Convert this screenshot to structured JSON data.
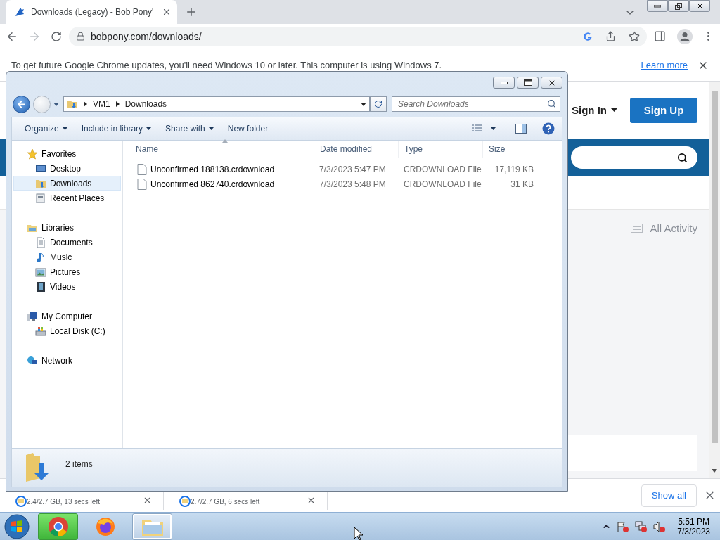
{
  "browser": {
    "tabs": [
      {
        "title": "Downloads (Legacy) - Bob Pony'",
        "selected": true
      }
    ],
    "address": "bobpony.com/downloads/",
    "infobar": {
      "message": "To get future Google Chrome updates, you'll need Windows 10 or later. This computer is using Windows 7.",
      "link": "Learn more"
    }
  },
  "page": {
    "sign_in": "Sign In",
    "sign_up": "Sign Up",
    "all_activity": "All Activity"
  },
  "download_shelf": {
    "items": [
      {
        "status": "2.4/2.7 GB, 13 secs left"
      },
      {
        "status": "2.7/2.7 GB, 6 secs left"
      }
    ],
    "show_all": "Show all"
  },
  "explorer": {
    "breadcrumb": [
      "VM1",
      "Downloads"
    ],
    "search": {
      "placeholder": "Search Downloads"
    },
    "toolbar": [
      {
        "label": "Organize",
        "menu": true
      },
      {
        "label": "Include in library",
        "menu": true
      },
      {
        "label": "Share with",
        "menu": true
      },
      {
        "label": "New folder",
        "menu": false
      }
    ],
    "nav": [
      {
        "label": "Favorites",
        "kind": "star",
        "selected": false,
        "children": [
          {
            "label": "Desktop",
            "kind": "desktop",
            "selected": false
          },
          {
            "label": "Downloads",
            "kind": "downloads",
            "selected": true
          },
          {
            "label": "Recent Places",
            "kind": "recent",
            "selected": false
          }
        ]
      },
      {
        "label": "Libraries",
        "kind": "library",
        "selected": false,
        "children": [
          {
            "label": "Documents",
            "kind": "documents",
            "selected": false
          },
          {
            "label": "Music",
            "kind": "music",
            "selected": false
          },
          {
            "label": "Pictures",
            "kind": "pictures",
            "selected": false
          },
          {
            "label": "Videos",
            "kind": "videos",
            "selected": false
          }
        ]
      },
      {
        "label": "My Computer",
        "kind": "computer",
        "selected": false,
        "children": [
          {
            "label": "Local Disk (C:)",
            "kind": "disk",
            "selected": false
          }
        ]
      },
      {
        "label": "Network",
        "kind": "network",
        "selected": false
      }
    ],
    "columns": [
      {
        "label": "Name",
        "sorted": true
      },
      {
        "label": "Date modified",
        "sorted": false
      },
      {
        "label": "Type",
        "sorted": false
      },
      {
        "label": "Size",
        "sorted": false
      }
    ],
    "files": [
      {
        "name": "Unconfirmed 188138.crdownload",
        "date": "7/3/2023 5:47 PM",
        "type": "CRDOWNLOAD File",
        "size": "17,119 KB"
      },
      {
        "name": "Unconfirmed 862740.crdownload",
        "date": "7/3/2023 5:48 PM",
        "type": "CRDOWNLOAD File",
        "size": "31 KB"
      }
    ],
    "status": "2 items"
  },
  "taskbar": {
    "apps": [
      {
        "kind": "chrome",
        "flashing": true,
        "selected": false
      },
      {
        "kind": "firefox",
        "flashing": false,
        "selected": false
      },
      {
        "kind": "explorer",
        "flashing": false,
        "selected": true
      }
    ],
    "time": "5:51 PM",
    "date": "7/3/2023"
  }
}
